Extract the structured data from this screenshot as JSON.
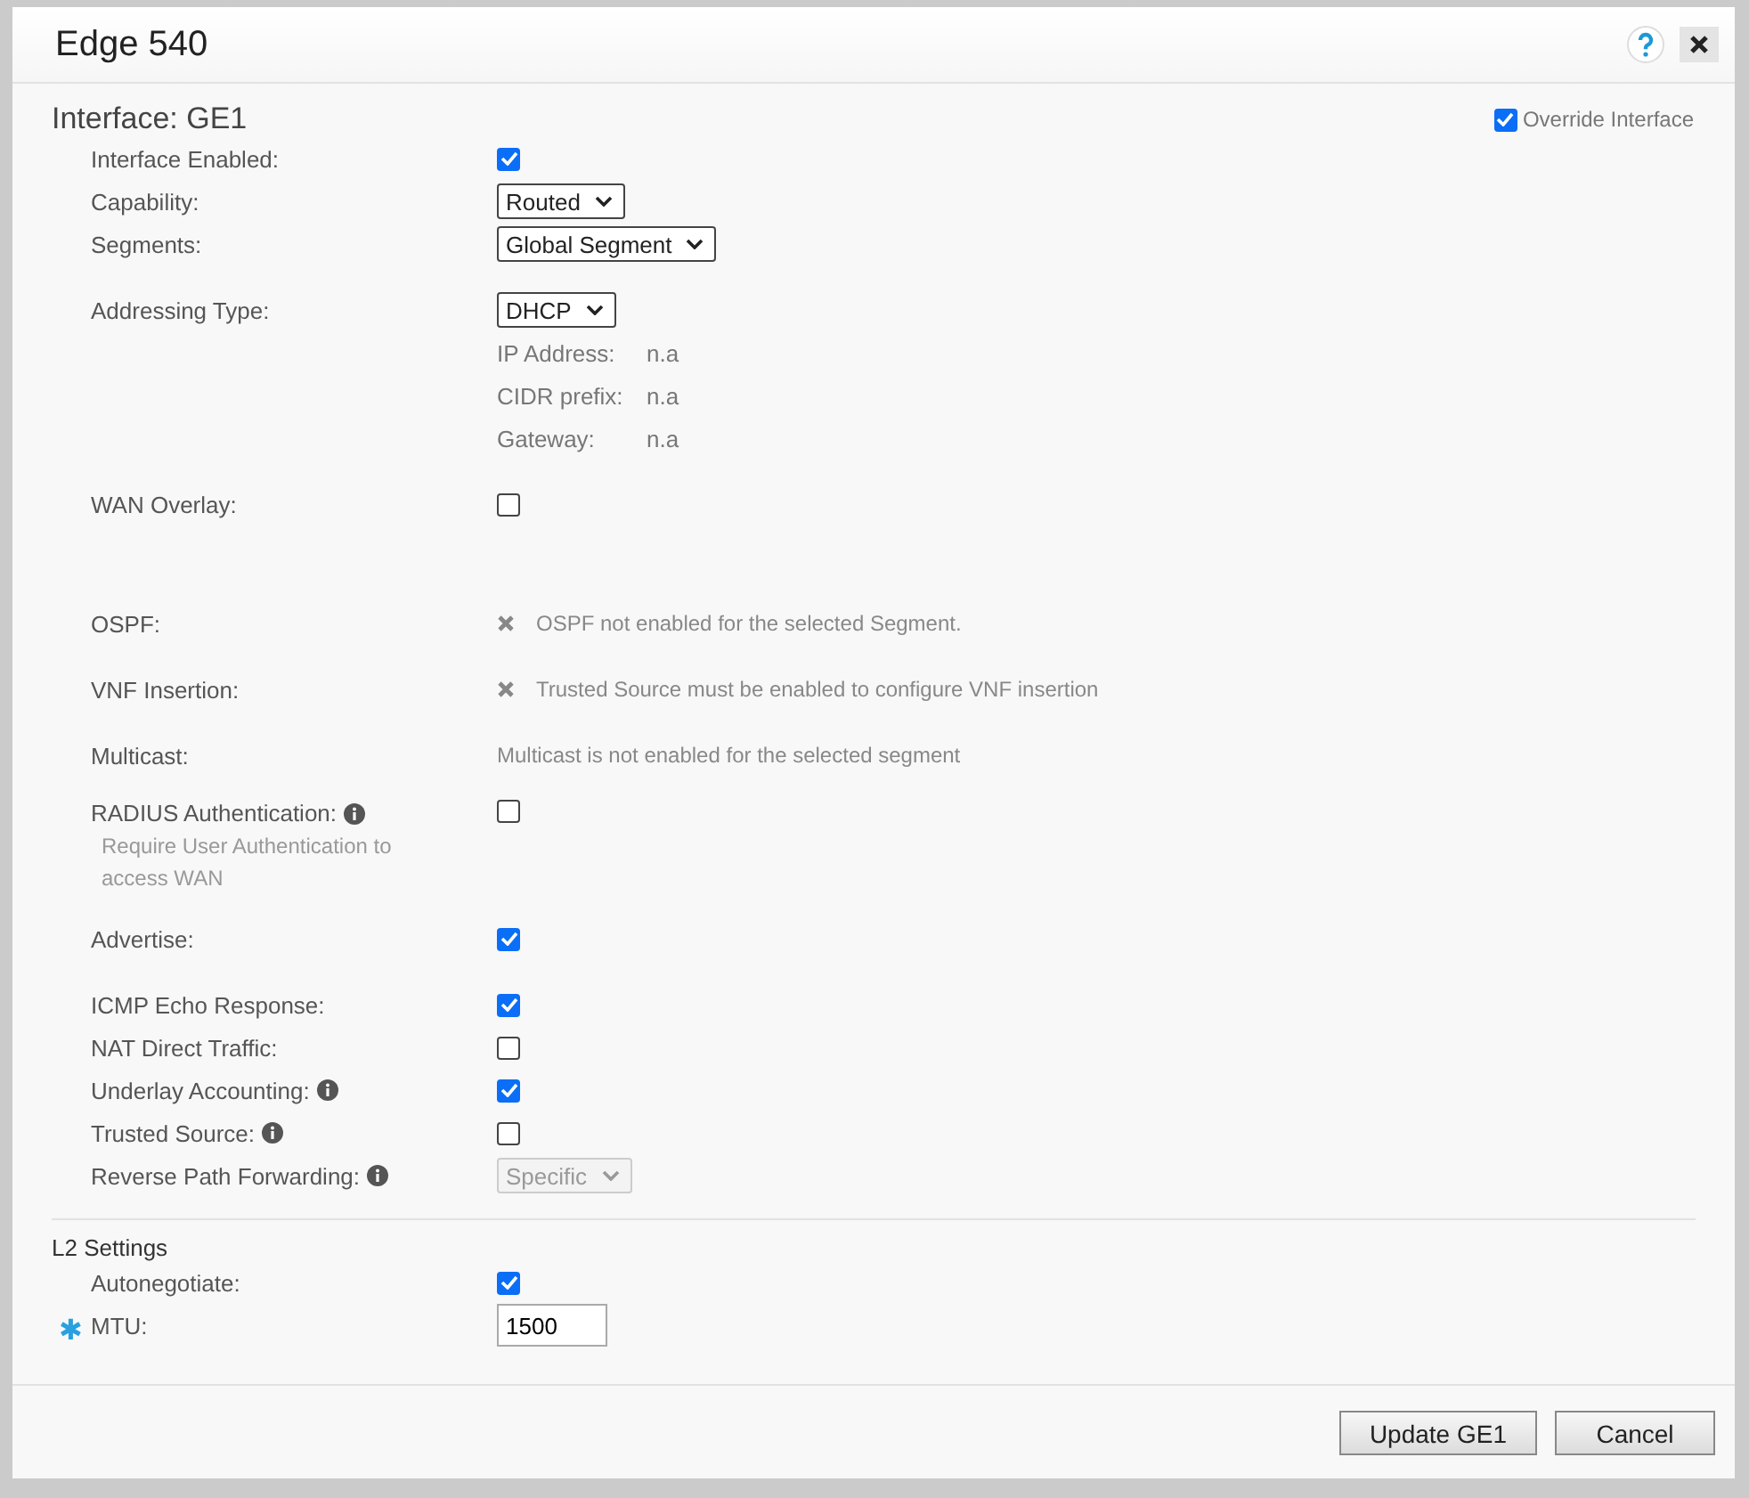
{
  "dialog": {
    "title": "Edge 540"
  },
  "interface": {
    "title": "Interface: GE1",
    "override": {
      "label": "Override Interface",
      "checked": true
    }
  },
  "groups": [
    [
      {
        "kind": "checkbox",
        "label": "Interface Enabled:",
        "checked": true
      },
      {
        "kind": "select",
        "label": "Capability:",
        "value": "Routed",
        "disabled": false
      },
      {
        "kind": "select",
        "label": "Segments:",
        "value": "Global Segment",
        "disabled": false
      }
    ],
    [
      {
        "kind": "select",
        "label": "Addressing Type:",
        "value": "DHCP",
        "disabled": false,
        "details": [
          {
            "label": "IP Address:",
            "value": "n.a"
          },
          {
            "label": "CIDR prefix:",
            "value": "n.a"
          },
          {
            "label": "Gateway:",
            "value": "n.a"
          }
        ]
      }
    ],
    [
      {
        "kind": "checkbox",
        "label": "WAN Overlay:",
        "checked": false
      }
    ],
    [
      {
        "kind": "blocked",
        "label": "OSPF:",
        "note": "OSPF not enabled for the selected Segment."
      }
    ],
    [
      {
        "kind": "blocked",
        "label": "VNF Insertion:",
        "note": "Trusted Source must be enabled to configure VNF insertion"
      }
    ],
    [
      {
        "kind": "note",
        "label": "Multicast:",
        "note": "Multicast is not enabled for the selected segment"
      }
    ],
    [
      {
        "kind": "checkbox",
        "label": "RADIUS Authentication:",
        "info": true,
        "hint": "Require User Authentication to access WAN",
        "checked": false
      }
    ],
    [
      {
        "kind": "checkbox",
        "label": "Advertise:",
        "checked": true
      }
    ],
    [
      {
        "kind": "checkbox",
        "label": "ICMP Echo Response:",
        "checked": true
      },
      {
        "kind": "checkbox",
        "label": "NAT Direct Traffic:",
        "checked": false
      },
      {
        "kind": "checkbox",
        "label": "Underlay Accounting:",
        "info": true,
        "checked": true
      },
      {
        "kind": "checkbox",
        "label": "Trusted Source:",
        "info": true,
        "checked": false
      },
      {
        "kind": "select",
        "label": "Reverse Path Forwarding:",
        "info": true,
        "value": "Specific",
        "disabled": true
      }
    ]
  ],
  "l2": {
    "title": "L2 Settings",
    "rows": [
      {
        "kind": "checkbox",
        "label": "Autonegotiate:",
        "checked": true
      },
      {
        "kind": "input",
        "label": "MTU:",
        "value": "1500",
        "required_mark": "✱"
      }
    ]
  },
  "buttons": [
    {
      "label": "Update GE1"
    },
    {
      "label": "Cancel"
    }
  ]
}
